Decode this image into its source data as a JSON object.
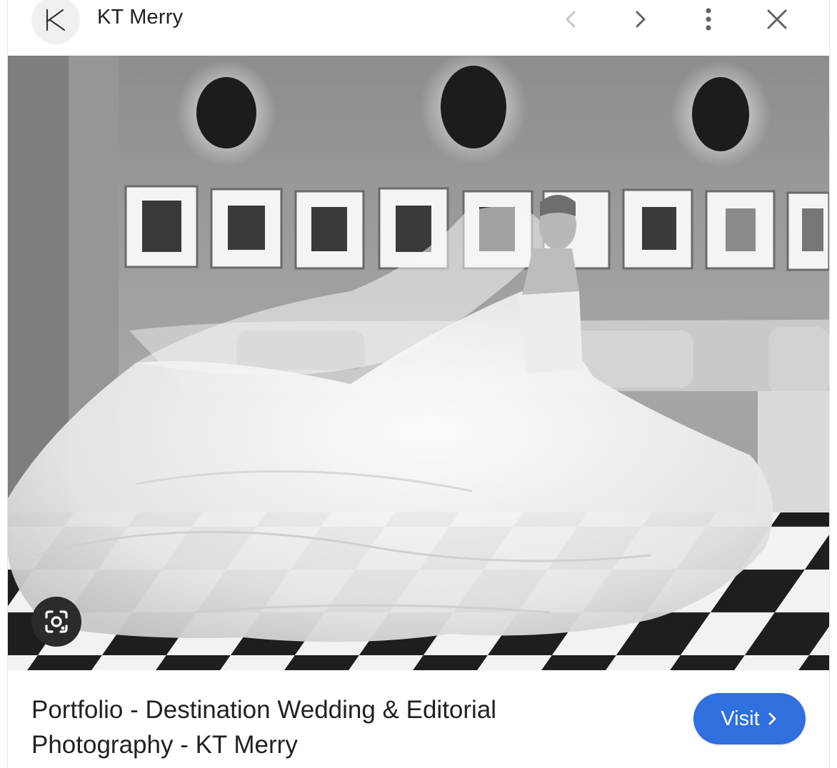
{
  "header": {
    "source_name": "KT Merry",
    "logo_icon": "kt-monogram-icon",
    "prev_icon": "chevron-left-icon",
    "next_icon": "chevron-right-icon",
    "more_icon": "more-vert-icon",
    "close_icon": "close-icon"
  },
  "image": {
    "subject": "black-and-white bridal portrait on checkered floor",
    "lens_icon": "google-lens-icon"
  },
  "footer": {
    "title_line1": "Portfolio - Destination Wedding & Editorial",
    "title_line2": "Photography - KT Merry",
    "visit_label": "Visit",
    "visit_icon": "chevron-right-icon"
  },
  "colors": {
    "accent": "#2f6fde",
    "text": "#202124",
    "icon_gray": "#5f6368",
    "icon_disabled": "#c4c7c5"
  }
}
